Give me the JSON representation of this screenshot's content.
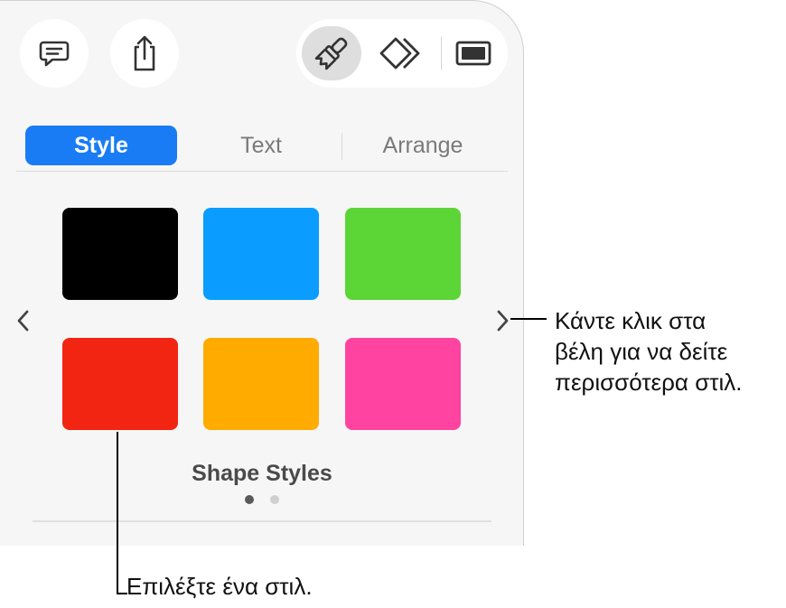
{
  "tabs": [
    {
      "label": "Style",
      "active": true
    },
    {
      "label": "Text",
      "active": false
    },
    {
      "label": "Arrange",
      "active": false
    }
  ],
  "toolbar": {
    "left_icons": [
      "comment-icon",
      "share-icon"
    ],
    "right_icons": [
      "format-brush-icon",
      "animate-icon",
      "document-icon"
    ],
    "selected_tool": "format-brush-icon"
  },
  "styles": {
    "swatches": [
      "#000000",
      "#0a9dff",
      "#5cd636",
      "#f22412",
      "#ffab00",
      "#ff43a0"
    ],
    "caption": "Shape Styles",
    "page_count": 2,
    "current_page": 1
  },
  "callouts": {
    "arrows_text": [
      "Κάντε κλικ στα",
      "βέλη για να δείτε",
      "περισσότερα στιλ."
    ],
    "select_text": "Επιλέξτε ένα στιλ."
  },
  "colors": {
    "accent": "#1a7cf5",
    "panel_bg": "#f6f6f6"
  }
}
